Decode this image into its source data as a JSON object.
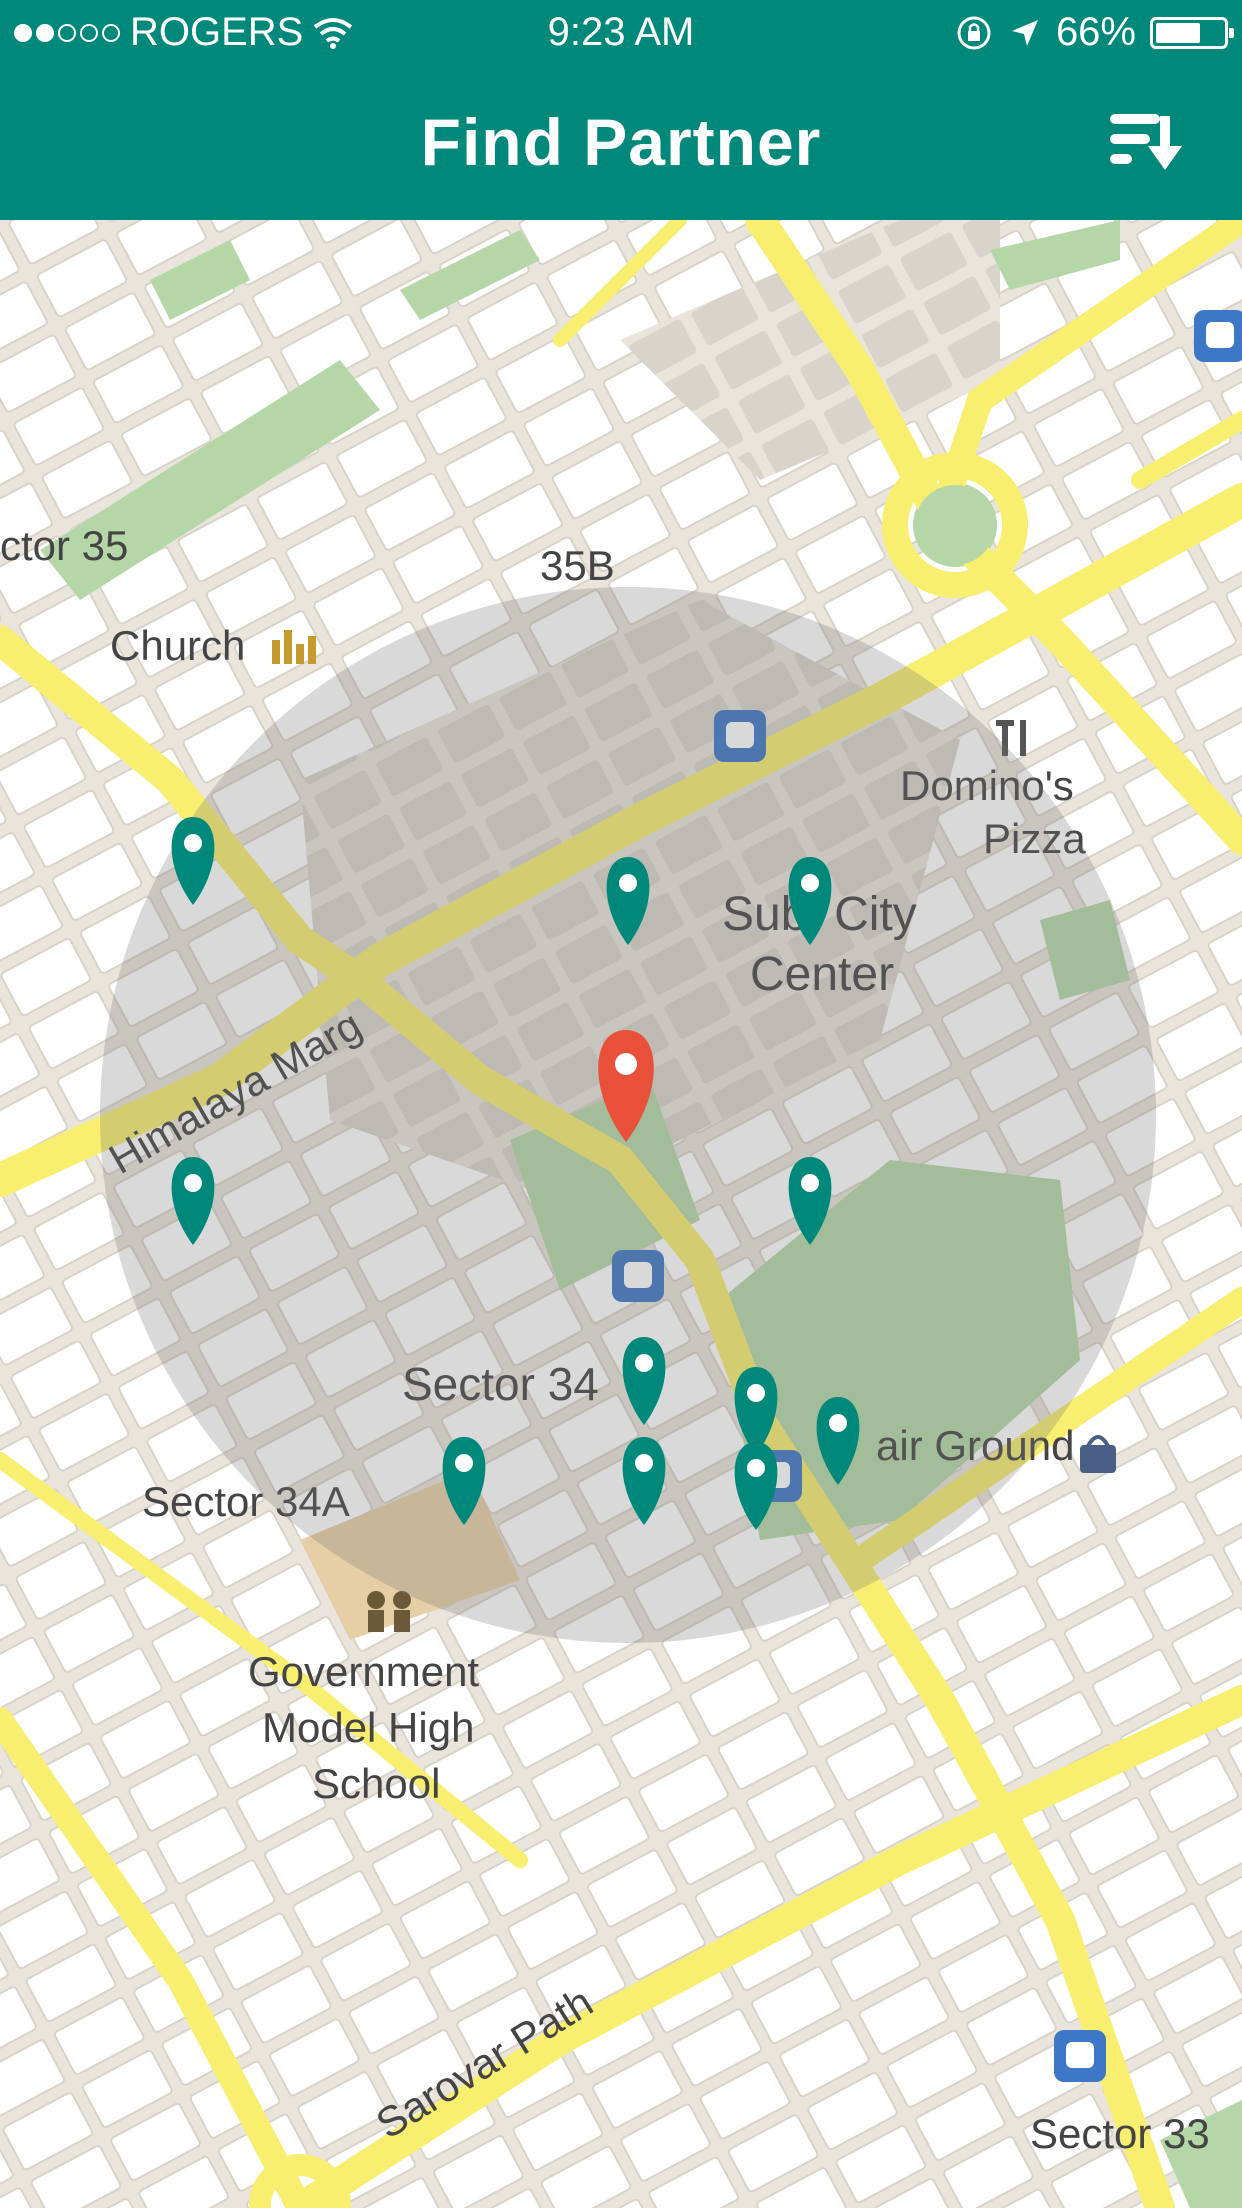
{
  "status_bar": {
    "carrier": "ROGERS",
    "time": "9:23 AM",
    "battery_percent": "66%",
    "signal_bars_filled": 2,
    "signal_bars_total": 5,
    "battery_level": 0.66
  },
  "app_bar": {
    "title": "Find Partner",
    "sort_icon": "sort-descending-icon"
  },
  "map": {
    "labels": {
      "sector_35": "ctor 35",
      "b35": "35B",
      "church": "Church",
      "dominos_1": "Domino's",
      "dominos_2": "Pizza",
      "sub_city_1": "Sub. City",
      "sub_city_2": "Center",
      "himalaya_marg": "Himalaya Marg",
      "sector_34": "Sector 34",
      "fair_ground": "air Ground",
      "sector_34a": "Sector 34A",
      "school_1": "Government",
      "school_2": "Model High",
      "school_3": "School",
      "sarovar_path": "Sarovar Path",
      "sector_33": "Sector 33"
    },
    "colors": {
      "partner_pin": "#00897b",
      "user_pin": "#e8503a",
      "road": "#f8ee6f",
      "park": "#b5d7a7",
      "block": "#ffffff",
      "radius_overlay": "rgba(120,120,120,0.28)"
    },
    "partner_pin_count": 12,
    "user_pin_count": 1
  }
}
